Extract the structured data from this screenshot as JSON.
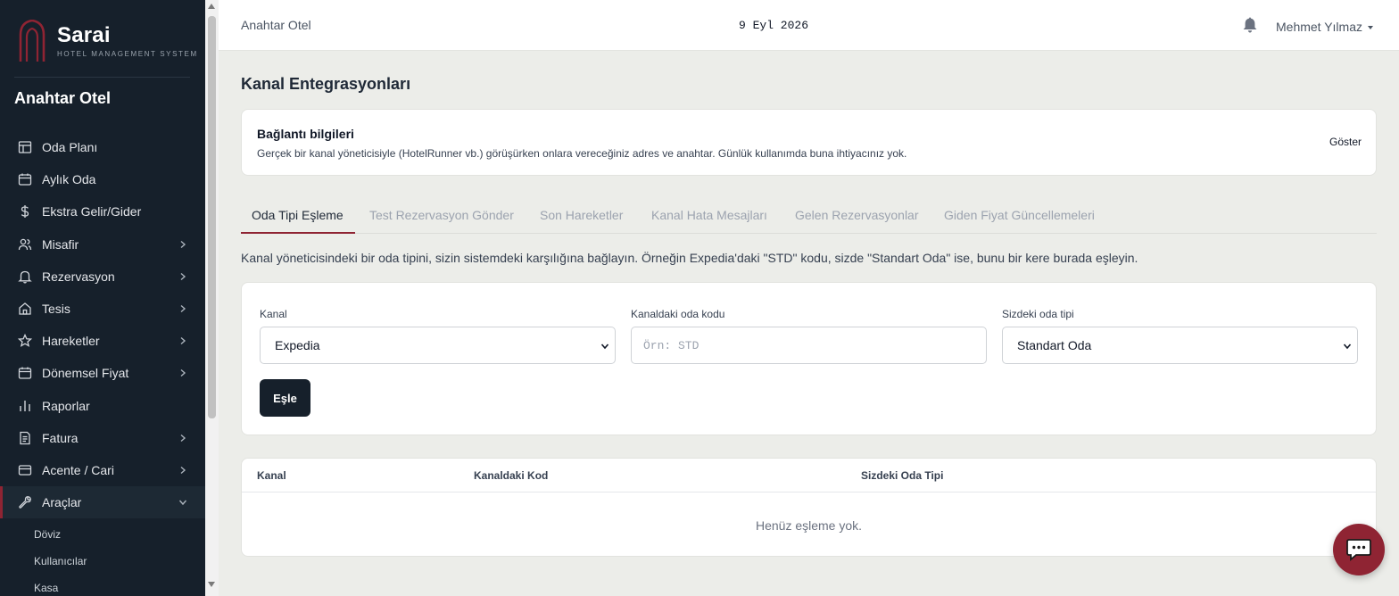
{
  "brand": {
    "name": "Sarai",
    "tagline": "HOTEL MANAGEMENT SYSTEM",
    "accent": "#8f2433",
    "sidebar_bg": "#16202b"
  },
  "sidebar": {
    "hotel_name": "Anahtar Otel",
    "items": [
      {
        "label": "Oda Planı",
        "icon": "grid-icon",
        "has_children": false
      },
      {
        "label": "Aylık Oda",
        "icon": "calendar-icon",
        "has_children": false
      },
      {
        "label": "Ekstra Gelir/Gider",
        "icon": "dollar-icon",
        "has_children": false
      },
      {
        "label": "Misafir",
        "icon": "users-icon",
        "has_children": true
      },
      {
        "label": "Rezervasyon",
        "icon": "bell-icon",
        "has_children": true
      },
      {
        "label": "Tesis",
        "icon": "home-icon",
        "has_children": true
      },
      {
        "label": "Hareketler",
        "icon": "star-icon",
        "has_children": true
      },
      {
        "label": "Dönemsel Fiyat",
        "icon": "calendar-icon",
        "has_children": true
      },
      {
        "label": "Raporlar",
        "icon": "bar-chart-icon",
        "has_children": false
      },
      {
        "label": "Fatura",
        "icon": "document-icon",
        "has_children": true
      },
      {
        "label": "Acente / Cari",
        "icon": "card-icon",
        "has_children": true
      },
      {
        "label": "Araçlar",
        "icon": "wrench-icon",
        "has_children": true,
        "expanded": true,
        "active": true
      }
    ],
    "sub_items": [
      {
        "label": "Döviz"
      },
      {
        "label": "Kullanıcılar"
      },
      {
        "label": "Kasa"
      }
    ]
  },
  "topbar": {
    "hotel": "Anahtar Otel",
    "date": "9 Eyl 2026",
    "user": "Mehmet Yılmaz"
  },
  "main": {
    "title": "Kanal Entegrasyonları",
    "connection": {
      "title": "Bağlantı bilgileri",
      "description": "Gerçek bir kanal yöneticisiyle (HotelRunner vb.) görüşürken onlara vereceğiniz adres ve anahtar. Günlük kullanımda buna ihtiyacınız yok.",
      "show_label": "Göster"
    },
    "tabs": [
      {
        "label": "Oda Tipi Eşleme",
        "active": true
      },
      {
        "label": "Test Rezervasyon Gönder"
      },
      {
        "label": "Son Hareketler"
      },
      {
        "label": "Kanal Hata Mesajları"
      },
      {
        "label": "Gelen Rezervasyonlar"
      },
      {
        "label": "Giden Fiyat Güncellemeleri"
      }
    ],
    "help_text": "Kanal yöneticisindeki bir oda tipini, sizin sistemdeki karşılığına bağlayın. Örneğin Expedia'daki \"STD\" kodu, sizde \"Standart Oda\" ise, bunu bir kere burada eşleyin.",
    "form": {
      "channel_label": "Kanal",
      "channel_value": "Expedia",
      "code_label": "Kanaldaki oda kodu",
      "code_placeholder": "Örn: STD",
      "code_value": "",
      "type_label": "Sizdeki oda tipi",
      "type_value": "Standart Oda",
      "submit_label": "Eşle"
    },
    "table": {
      "columns": [
        "Kanal",
        "Kanaldaki Kod",
        "Sizdeki Oda Tipi"
      ],
      "empty_text": "Henüz eşleme yok."
    }
  }
}
